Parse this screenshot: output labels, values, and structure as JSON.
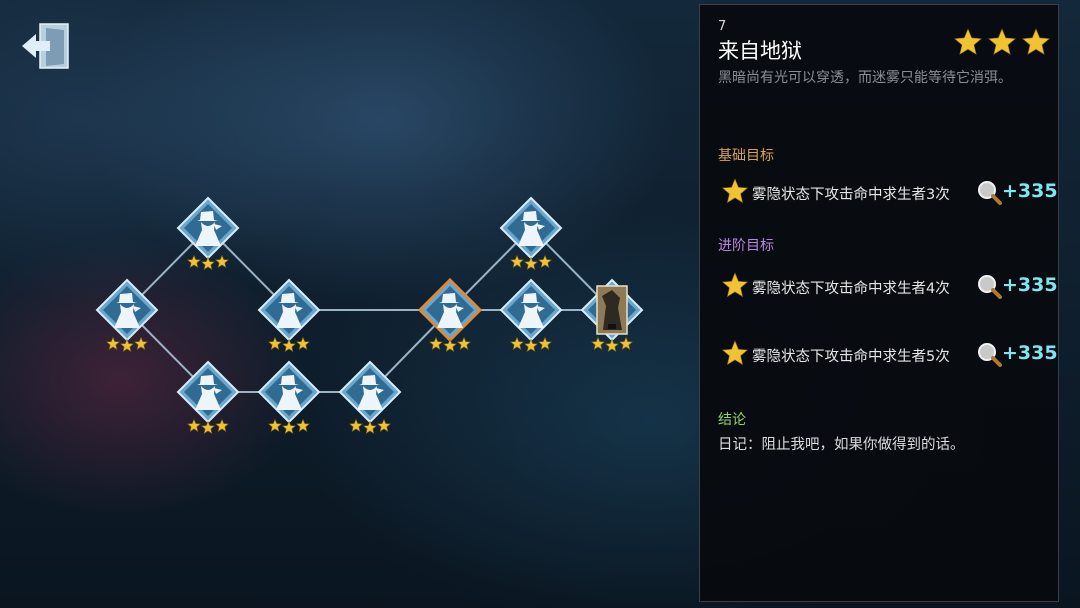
{
  "colors": {
    "basic_goal_title": "#d6a25a",
    "advanced_goal_title": "#b985e0",
    "conclusion_title": "#8fd46a",
    "reward": "#7fe6f0"
  },
  "top_left": {
    "icon": "exit-door-icon"
  },
  "map": {
    "nodes": [
      {
        "id": "n1",
        "stars": 3,
        "selected": false,
        "icon": "detective-silhouette-icon"
      },
      {
        "id": "n2",
        "stars": 3,
        "selected": false,
        "icon": "detective-silhouette-icon"
      },
      {
        "id": "n3",
        "stars": 3,
        "selected": false,
        "icon": "detective-silhouette-icon"
      },
      {
        "id": "n4",
        "stars": 3,
        "selected": false,
        "icon": "detective-silhouette-icon"
      },
      {
        "id": "n5",
        "stars": 3,
        "selected": false,
        "icon": "detective-silhouette-icon"
      },
      {
        "id": "n6",
        "stars": 3,
        "selected": false,
        "icon": "detective-silhouette-icon"
      },
      {
        "id": "n7",
        "stars": 3,
        "selected": true,
        "icon": "detective-silhouette-icon"
      },
      {
        "id": "n8",
        "stars": 3,
        "selected": false,
        "icon": "detective-silhouette-icon"
      },
      {
        "id": "n9",
        "stars": 3,
        "selected": false,
        "icon": "detective-silhouette-icon"
      },
      {
        "id": "n10",
        "stars": 3,
        "selected": false,
        "icon": "hunter-portrait-icon"
      }
    ]
  },
  "panel": {
    "level_number": "7",
    "title": "来自地狱",
    "rating_stars": 3,
    "description": "黑暗尚有光可以穿透，而迷雾只能等待它消弭。",
    "basic_title": "基础目标",
    "basic_goals": [
      {
        "text": "雾隐状态下攻击命中求生者3次",
        "reward": "+335"
      }
    ],
    "advanced_title": "进阶目标",
    "advanced_goals": [
      {
        "text": "雾隐状态下攻击命中求生者4次",
        "reward": "+335"
      },
      {
        "text": "雾隐状态下攻击命中求生者5次",
        "reward": "+335"
      }
    ],
    "conclusion_title": "结论",
    "conclusion_text": "日记：阻止我吧，如果你做得到的话。"
  }
}
